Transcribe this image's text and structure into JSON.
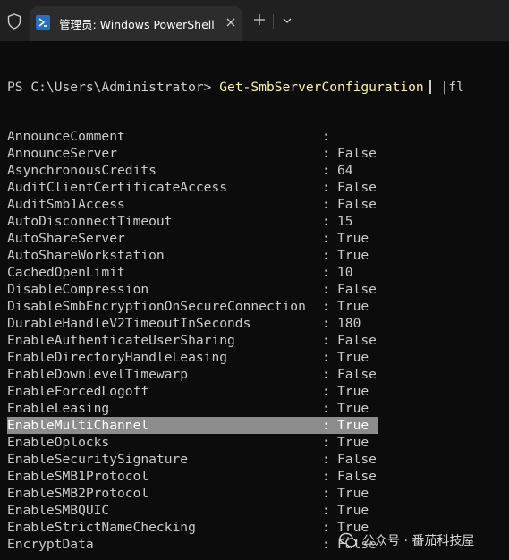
{
  "window": {
    "tab_title": "管理员: Windows PowerShell"
  },
  "terminal": {
    "prompt": "PS C:\\Users\\Administrator> ",
    "command": "Get-SmbServerConfiguration",
    "pipe": " |fl",
    "rows": [
      {
        "key": "AnnounceComment",
        "value": ""
      },
      {
        "key": "AnnounceServer",
        "value": "False"
      },
      {
        "key": "AsynchronousCredits",
        "value": "64"
      },
      {
        "key": "AuditClientCertificateAccess",
        "value": "False"
      },
      {
        "key": "AuditSmb1Access",
        "value": "False"
      },
      {
        "key": "AutoDisconnectTimeout",
        "value": "15"
      },
      {
        "key": "AutoShareServer",
        "value": "True"
      },
      {
        "key": "AutoShareWorkstation",
        "value": "True"
      },
      {
        "key": "CachedOpenLimit",
        "value": "10"
      },
      {
        "key": "DisableCompression",
        "value": "False"
      },
      {
        "key": "DisableSmbEncryptionOnSecureConnection",
        "value": "True"
      },
      {
        "key": "DurableHandleV2TimeoutInSeconds",
        "value": "180"
      },
      {
        "key": "EnableAuthenticateUserSharing",
        "value": "False"
      },
      {
        "key": "EnableDirectoryHandleLeasing",
        "value": "True"
      },
      {
        "key": "EnableDownlevelTimewarp",
        "value": "False"
      },
      {
        "key": "EnableForcedLogoff",
        "value": "True"
      },
      {
        "key": "EnableLeasing",
        "value": "True"
      },
      {
        "key": "EnableMultiChannel",
        "value": "True",
        "highlighted": true
      },
      {
        "key": "EnableOplocks",
        "value": "True"
      },
      {
        "key": "EnableSecuritySignature",
        "value": "False"
      },
      {
        "key": "EnableSMB1Protocol",
        "value": "False"
      },
      {
        "key": "EnableSMB2Protocol",
        "value": "True"
      },
      {
        "key": "EnableSMBQUIC",
        "value": "True"
      },
      {
        "key": "EnableStrictNameChecking",
        "value": "True"
      },
      {
        "key": "EncryptData",
        "value": "False"
      }
    ]
  },
  "watermark": {
    "text": "公众号 · 番茄科技屋"
  },
  "colors": {
    "terminal_bg": "#0c0c0c",
    "text": "#cccccc",
    "command": "#f9f1a5",
    "highlight": "#8c8c8c",
    "tabbar_bg": "#202020",
    "tab_bg": "#2c2c2c",
    "ps_icon": "#2671be"
  },
  "icons": {
    "shield": "shield-icon",
    "powershell": "powershell-icon",
    "close": "close-icon",
    "new_tab": "plus-icon",
    "dropdown": "chevron-down-icon",
    "watermark_logo": "wechat-logo-icon"
  }
}
